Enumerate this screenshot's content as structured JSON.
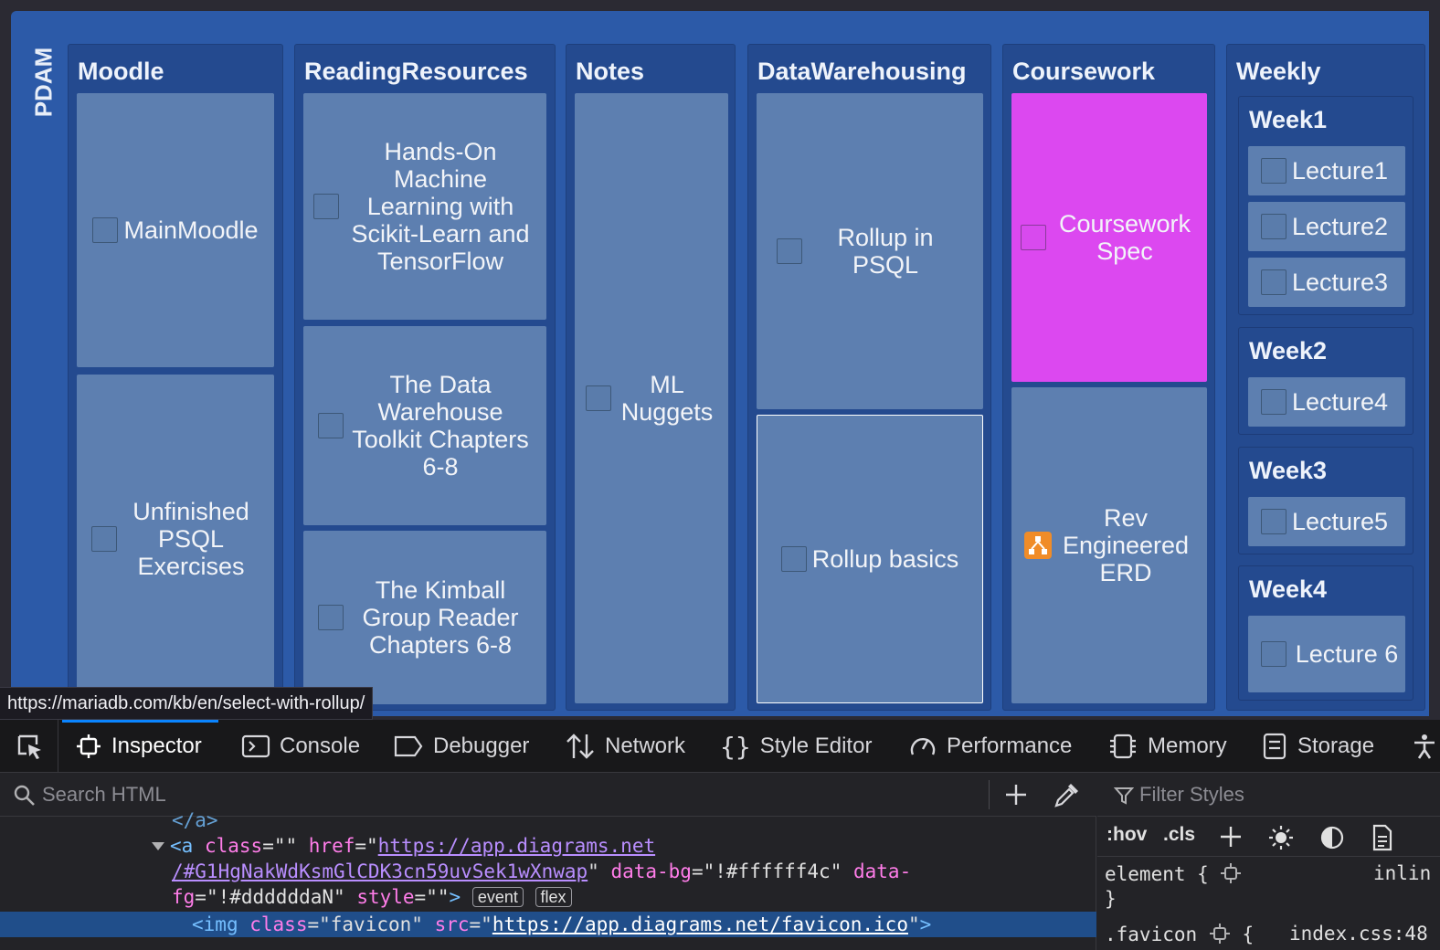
{
  "board": {
    "title": "PDAM",
    "columns": {
      "moodle": {
        "title": "Moodle",
        "cards": [
          "MainMoodle",
          "Unfinished PSQL Exercises"
        ]
      },
      "reading": {
        "title": "ReadingResources",
        "cards": [
          "Hands-On Machine Learning with Scikit-Learn and TensorFlow",
          "The Data Warehouse Toolkit Chapters 6-8",
          "The Kimball Group Reader Chapters 6-8"
        ]
      },
      "notes": {
        "title": "Notes",
        "cards": [
          "ML Nuggets"
        ]
      },
      "dw": {
        "title": "DataWarehousing",
        "cards": [
          "Rollup in PSQL",
          "Rollup basics"
        ]
      },
      "coursework": {
        "title": "Coursework",
        "cards": [
          "Coursework Spec",
          "Rev Engineered ERD"
        ]
      },
      "weekly": {
        "title": "Weekly",
        "weeks": [
          {
            "title": "Week1",
            "lectures": [
              "Lecture1",
              "Lecture2",
              "Lecture3"
            ]
          },
          {
            "title": "Week2",
            "lectures": [
              "Lecture4"
            ]
          },
          {
            "title": "Week3",
            "lectures": [
              "Lecture5"
            ]
          },
          {
            "title": "Week4",
            "lectures": [
              "Lecture 6"
            ]
          }
        ]
      }
    },
    "colors": {
      "board_bg": "#2c5aa8",
      "card_bg": "#5d7fb0",
      "accent_card": "#dc48f0",
      "column_bg": "#244a8f"
    }
  },
  "status_url": "https://mariadb.com/kb/en/select-with-rollup/",
  "devtools": {
    "tabs": [
      "Inspector",
      "Console",
      "Debugger",
      "Network",
      "Style Editor",
      "Performance",
      "Memory",
      "Storage"
    ],
    "active_tab": "Inspector",
    "search_placeholder": "Search HTML",
    "filter_placeholder": "Filter Styles",
    "code": {
      "line0": "</a>",
      "a_tag": "a",
      "attr_class": "class",
      "class_val": "\"\"",
      "attr_href": "href",
      "href_part1": "https://app.diagrams.net",
      "href_part2": "/#G1HgNakWdKsmGlCDK3cn59uvSek1wXnwap",
      "attr_databg": "data-bg",
      "databg_val": "\"!#ffffff4c\"",
      "attr_datafg_1": "data-",
      "attr_datafg_2": "fg",
      "datafg_val": "\"!#ddddddaN\"",
      "attr_style": "style",
      "style_val": "\"\"",
      "badge_event": "event",
      "badge_flex": "flex",
      "img_tag": "img",
      "img_class_val": "\"favicon\"",
      "attr_src": "src",
      "img_src": "https://app.diagrams.net/favicon.ico"
    },
    "rules": {
      "hov": ":hov",
      "cls": ".cls",
      "element_rule": "element {",
      "element_source": "inlin",
      "close_brace": "}",
      "favicon_rule": ".favicon",
      "favicon_open": "{",
      "favicon_source": "index.css:48"
    }
  }
}
